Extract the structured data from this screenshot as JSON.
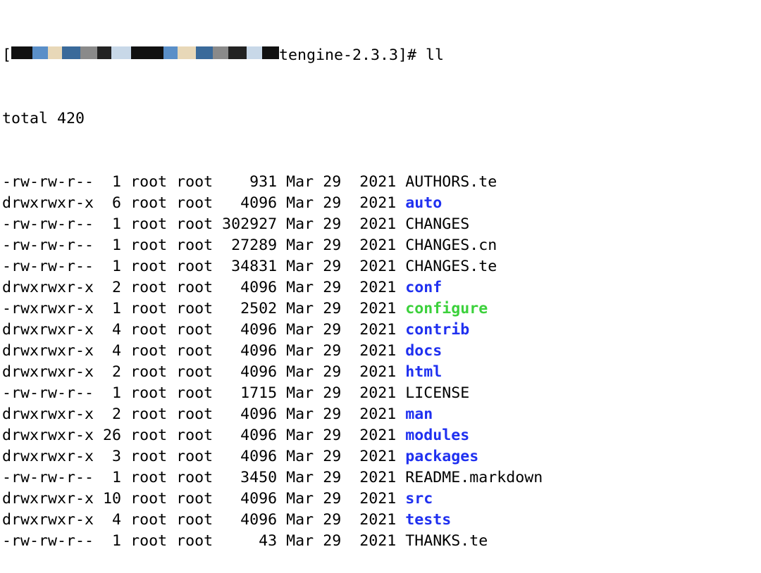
{
  "prompt": {
    "open_bracket": "[",
    "redacted_host": "",
    "tail": "tengine-2.3.3]# ll",
    "colors": [
      "#111111",
      "#5a8fc8",
      "#e8d8b8",
      "#3a6a9a",
      "#8a8a8a",
      "#222222",
      "#c8d8e8",
      "#111111"
    ]
  },
  "total": "total 420",
  "listing": [
    {
      "perms": "-rw-rw-r--",
      "links": "1",
      "owner": "root",
      "group": "root",
      "size": "931",
      "month": "Mar",
      "day": "29",
      "year": "2021",
      "name": "AUTHORS.te",
      "type": "file"
    },
    {
      "perms": "drwxrwxr-x",
      "links": "6",
      "owner": "root",
      "group": "root",
      "size": "4096",
      "month": "Mar",
      "day": "29",
      "year": "2021",
      "name": "auto",
      "type": "dir"
    },
    {
      "perms": "-rw-rw-r--",
      "links": "1",
      "owner": "root",
      "group": "root",
      "size": "302927",
      "month": "Mar",
      "day": "29",
      "year": "2021",
      "name": "CHANGES",
      "type": "file"
    },
    {
      "perms": "-rw-rw-r--",
      "links": "1",
      "owner": "root",
      "group": "root",
      "size": "27289",
      "month": "Mar",
      "day": "29",
      "year": "2021",
      "name": "CHANGES.cn",
      "type": "file"
    },
    {
      "perms": "-rw-rw-r--",
      "links": "1",
      "owner": "root",
      "group": "root",
      "size": "34831",
      "month": "Mar",
      "day": "29",
      "year": "2021",
      "name": "CHANGES.te",
      "type": "file"
    },
    {
      "perms": "drwxrwxr-x",
      "links": "2",
      "owner": "root",
      "group": "root",
      "size": "4096",
      "month": "Mar",
      "day": "29",
      "year": "2021",
      "name": "conf",
      "type": "dir"
    },
    {
      "perms": "-rwxrwxr-x",
      "links": "1",
      "owner": "root",
      "group": "root",
      "size": "2502",
      "month": "Mar",
      "day": "29",
      "year": "2021",
      "name": "configure",
      "type": "exec"
    },
    {
      "perms": "drwxrwxr-x",
      "links": "4",
      "owner": "root",
      "group": "root",
      "size": "4096",
      "month": "Mar",
      "day": "29",
      "year": "2021",
      "name": "contrib",
      "type": "dir"
    },
    {
      "perms": "drwxrwxr-x",
      "links": "4",
      "owner": "root",
      "group": "root",
      "size": "4096",
      "month": "Mar",
      "day": "29",
      "year": "2021",
      "name": "docs",
      "type": "dir"
    },
    {
      "perms": "drwxrwxr-x",
      "links": "2",
      "owner": "root",
      "group": "root",
      "size": "4096",
      "month": "Mar",
      "day": "29",
      "year": "2021",
      "name": "html",
      "type": "dir"
    },
    {
      "perms": "-rw-rw-r--",
      "links": "1",
      "owner": "root",
      "group": "root",
      "size": "1715",
      "month": "Mar",
      "day": "29",
      "year": "2021",
      "name": "LICENSE",
      "type": "file"
    },
    {
      "perms": "drwxrwxr-x",
      "links": "2",
      "owner": "root",
      "group": "root",
      "size": "4096",
      "month": "Mar",
      "day": "29",
      "year": "2021",
      "name": "man",
      "type": "dir"
    },
    {
      "perms": "drwxrwxr-x",
      "links": "26",
      "owner": "root",
      "group": "root",
      "size": "4096",
      "month": "Mar",
      "day": "29",
      "year": "2021",
      "name": "modules",
      "type": "dir"
    },
    {
      "perms": "drwxrwxr-x",
      "links": "3",
      "owner": "root",
      "group": "root",
      "size": "4096",
      "month": "Mar",
      "day": "29",
      "year": "2021",
      "name": "packages",
      "type": "dir"
    },
    {
      "perms": "-rw-rw-r--",
      "links": "1",
      "owner": "root",
      "group": "root",
      "size": "3450",
      "month": "Mar",
      "day": "29",
      "year": "2021",
      "name": "README.markdown",
      "type": "file"
    },
    {
      "perms": "drwxrwxr-x",
      "links": "10",
      "owner": "root",
      "group": "root",
      "size": "4096",
      "month": "Mar",
      "day": "29",
      "year": "2021",
      "name": "src",
      "type": "dir"
    },
    {
      "perms": "drwxrwxr-x",
      "links": "4",
      "owner": "root",
      "group": "root",
      "size": "4096",
      "month": "Mar",
      "day": "29",
      "year": "2021",
      "name": "tests",
      "type": "dir"
    },
    {
      "perms": "-rw-rw-r--",
      "links": "1",
      "owner": "root",
      "group": "root",
      "size": "43",
      "month": "Mar",
      "day": "29",
      "year": "2021",
      "name": "THANKS.te",
      "type": "file"
    }
  ],
  "colors": {
    "dir": "#1f30f0",
    "exec": "#3cd13c",
    "text": "#000000",
    "background": "#ffffff"
  }
}
